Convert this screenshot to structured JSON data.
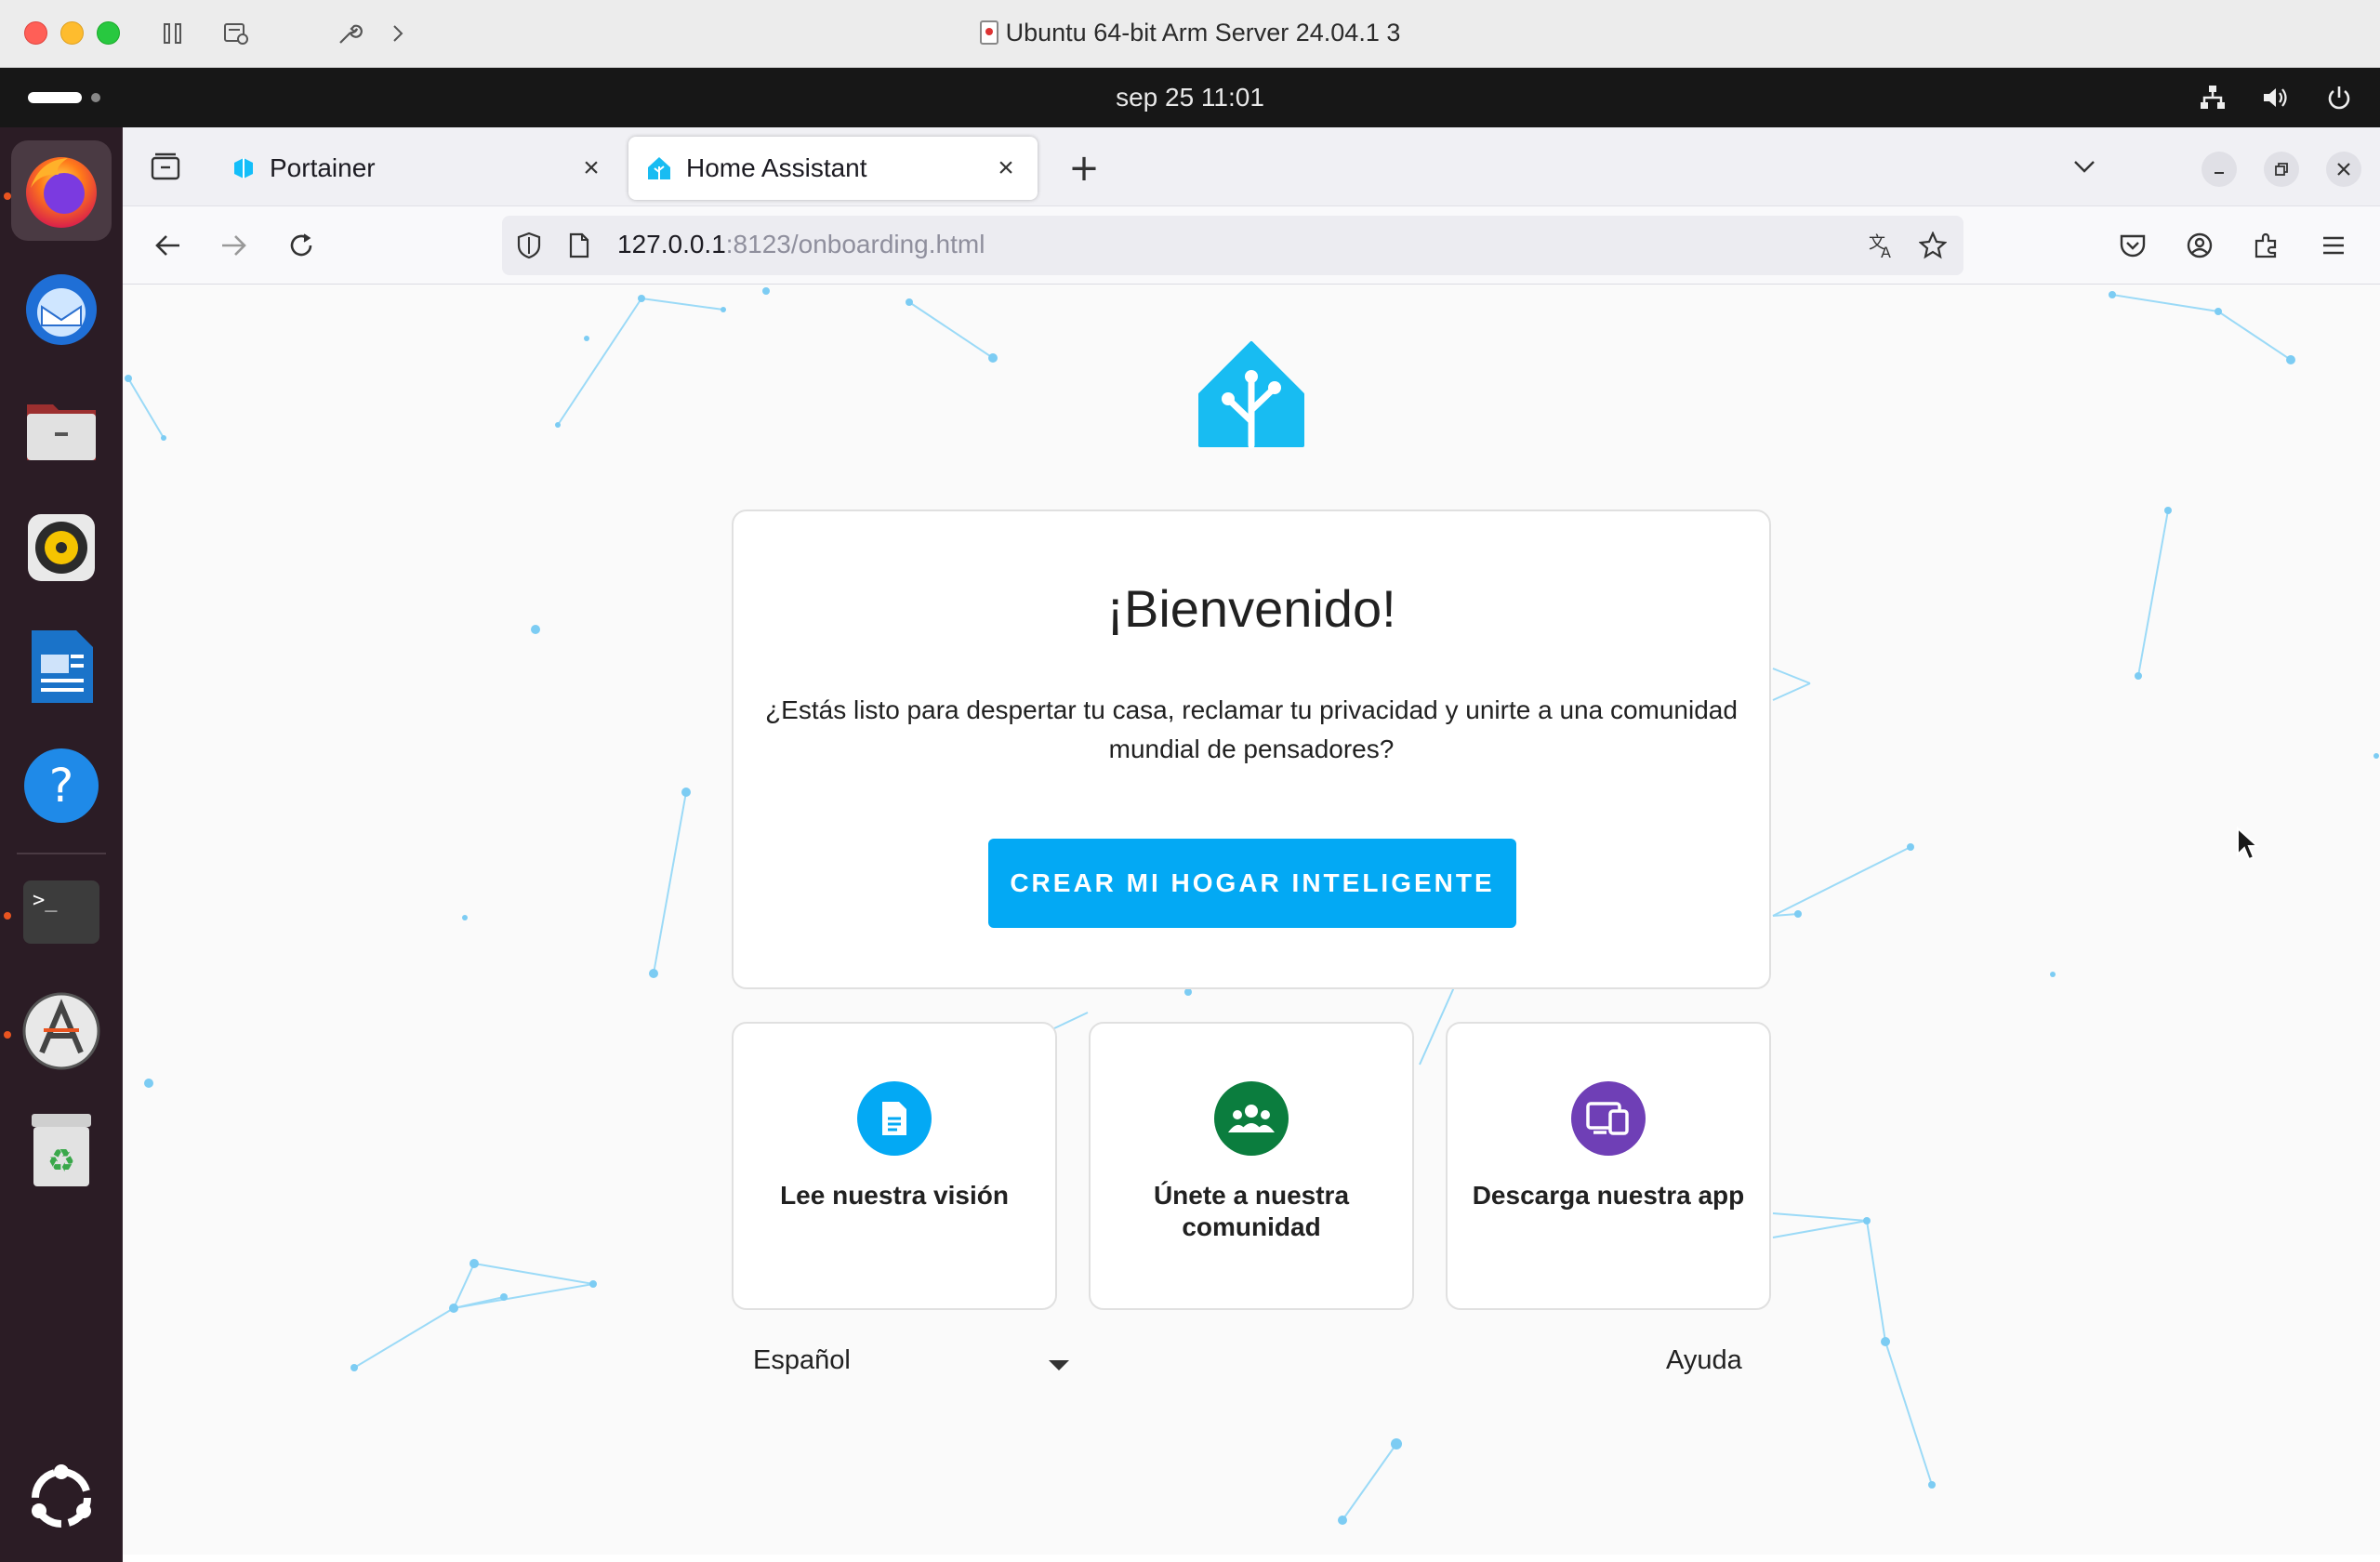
{
  "vm_window": {
    "title": "Ubuntu 64-bit Arm Server 24.04.1 3"
  },
  "topbar": {
    "clock": "sep 25  11:01"
  },
  "dock": {
    "apps": [
      "firefox-icon",
      "thunderbird-icon",
      "files-icon",
      "rhythmbox-icon",
      "writer-icon",
      "help-icon",
      "terminal-icon",
      "app-center-icon",
      "trash-icon",
      "show-apps-icon"
    ]
  },
  "browser": {
    "tabs": [
      {
        "label": "Portainer",
        "active": false
      },
      {
        "label": "Home Assistant",
        "active": true
      }
    ],
    "url_host": "127.0.0.1",
    "url_rest": ":8123/onboarding.html"
  },
  "page": {
    "welcome": "¡Bienvenido!",
    "tagline": "¿Estás listo para despertar tu casa, reclamar tu privacidad y unirte a una comunidad mundial de pensadores?",
    "cta": "CREAR MI HOGAR INTELIGENTE",
    "cards": [
      {
        "label": "Lee nuestra visión",
        "icon": "document-icon",
        "color": "#03a9f4"
      },
      {
        "label": "Únete a nuestra comunidad",
        "icon": "community-icon",
        "color": "#0b7d3e"
      },
      {
        "label": "Descarga nuestra app",
        "icon": "devices-icon",
        "color": "#6f3fb6"
      }
    ],
    "language": "Español",
    "help": "Ayuda"
  },
  "colors": {
    "accent": "#03a9f4",
    "dock_bg": "#2b1c25",
    "topbar_bg": "#171717"
  }
}
